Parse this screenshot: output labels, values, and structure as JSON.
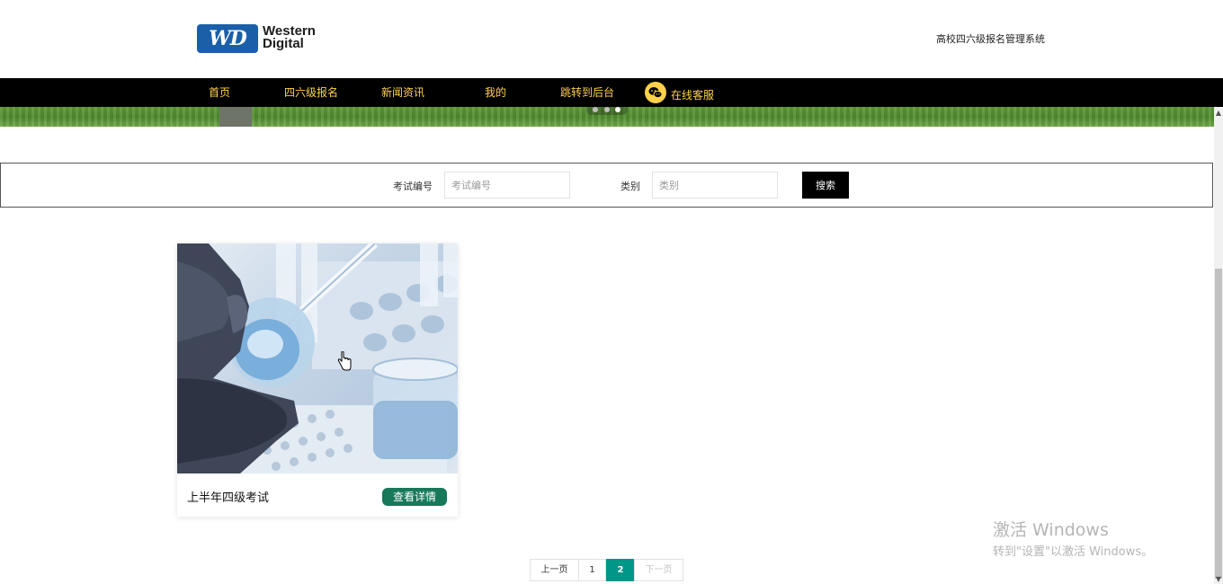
{
  "header": {
    "logo_badge": "WD",
    "logo_line1": "Western",
    "logo_line2": "Digital",
    "site_title": "高校四六级报名管理系统"
  },
  "nav": {
    "items": [
      {
        "label": "首页"
      },
      {
        "label": "四六级报名"
      },
      {
        "label": "新闻资讯"
      },
      {
        "label": "我的"
      },
      {
        "label": "跳转到后台"
      }
    ],
    "service_label": "在线客服"
  },
  "search": {
    "exam_no_label": "考试编号",
    "exam_no_placeholder": "考试编号",
    "exam_no_value": "",
    "category_label": "类别",
    "category_placeholder": "类别",
    "category_value": "",
    "button_label": "搜索"
  },
  "cards": [
    {
      "title": "上半年四级考试",
      "button_label": "查看详情"
    }
  ],
  "pagination": {
    "prev_label": "上一页",
    "pages": [
      "1",
      "2"
    ],
    "current": "2",
    "next_label": "下一页"
  },
  "watermark": {
    "line1": "激活 Windows",
    "line2": "转到\"设置\"以激活 Windows。"
  },
  "colors": {
    "nav_bg": "#000000",
    "nav_text": "#ffd24a",
    "accent_green": "#17785a",
    "pager_active": "#009688",
    "logo_blue": "#1b5fa8"
  }
}
